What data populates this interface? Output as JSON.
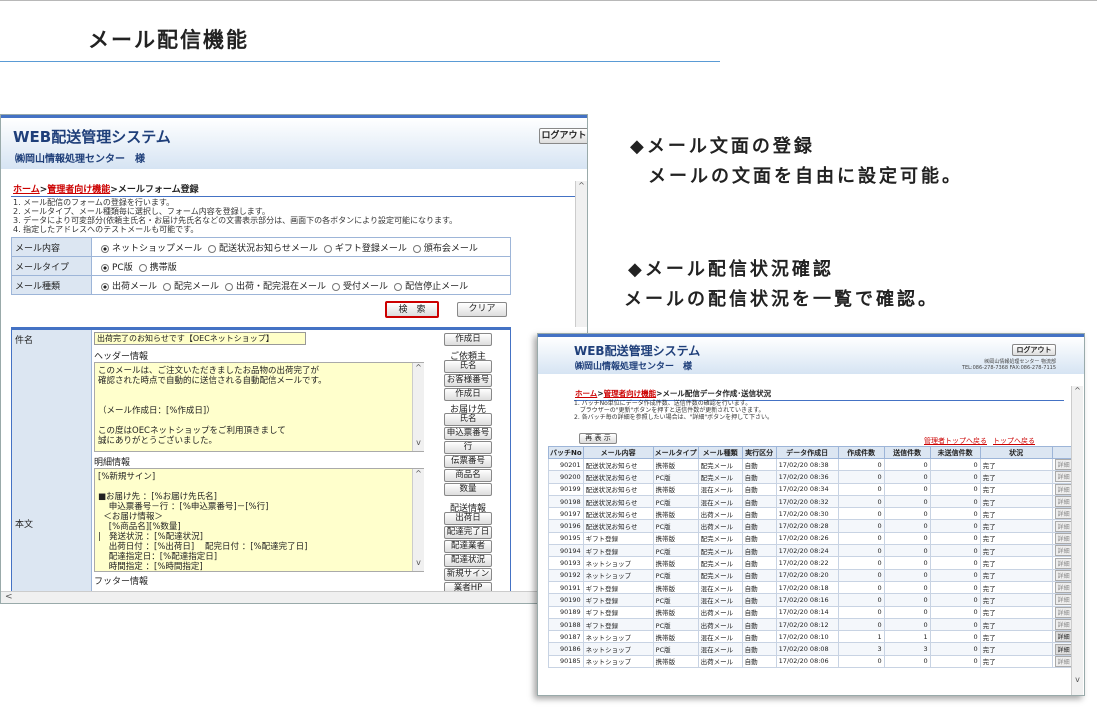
{
  "slide_title": "メール配信機能",
  "notes": {
    "n1_head": "◆メール文面の登録",
    "n1_body": "メールの文面を自由に設定可能。",
    "n2_head": "◆メール配信状況確認",
    "n2_body": "メールの配信状況を一覧で確認。"
  },
  "screen1": {
    "app_title": "WEB配送管理システム",
    "user": "㈱岡山情報処理センター　様",
    "logout": "ログアウト",
    "crumb_home": "ホーム",
    "crumb_sep": ">",
    "crumb_admin": "管理者向け機能",
    "crumb_page": ">メールフォーム登録",
    "instructions": [
      "1. メール配信のフォームの登録を行います。",
      "2. メールタイプ、メール種類毎に選択し、フォーム内容を登録します。",
      "3. データにより可変部分(依頼主氏名・お届け先氏名などの文書表示部分は、画面下の各ボタンにより設定可能になります。",
      "4. 指定したアドレスへのテストメールも可能です。"
    ],
    "form": [
      {
        "label": "メール内容",
        "options": [
          "ネットショップメール",
          "配送状況お知らせメール",
          "ギフト登録メール",
          "頒布会メール"
        ],
        "selected": 0
      },
      {
        "label": "メールタイプ",
        "options": [
          "PC版",
          "携帯版"
        ],
        "selected": 0
      },
      {
        "label": "メール種類",
        "options": [
          "出荷メール",
          "配完メール",
          "出荷・配完混在メール",
          "受付メール",
          "配信停止メール"
        ],
        "selected": 0
      }
    ],
    "search": "検　索",
    "clear": "クリア",
    "subject_label": "件名",
    "subject_value": "出荷完了のお知らせです【OECネットショップ】",
    "body_label": "本文",
    "header_label": "ヘッダー情報",
    "header_text": "このメールは、ご注文いただきましたお品物の出荷完了が\n確認された時点で自動的に送信される自動配信メールです。\n\n\n（メール作成日：[%作成日]）\n\nこの度はOECネットショップをご利用頂きまして\n誠にありがとうございました。",
    "detail_label": "明細情報",
    "detail_text": "[%新規サイン]\n\n■お届け先 ：[%お届け先氏名]\n    申込票番号－行 ：[%申込票番号]－[%行]\n  ＜お届け情報＞\n    [%商品名][%数量]\n|   発送状況 ：[%配達状況]\n    出荷日付 ：[%出荷日]    配完日付 ：[%配達完了日]\n    配達指定日：[%配達指定日]\n    時間指定 ：[%時間指定]",
    "footer_label": "フッター情報",
    "side_buttons": {
      "created": "作成日",
      "client_label": "ご依頼主",
      "name1": "氏名",
      "customer_no": "お客様番号",
      "created2": "作成日",
      "dest_label": "お届け先",
      "name2": "氏名",
      "app_no": "申込票番号",
      "line": "行",
      "slip_no": "伝票番号",
      "product": "商品名",
      "qty": "数量",
      "ship_info": "配送情報",
      "ship_date": "出荷日",
      "delivered_date": "配達完了日",
      "carrier": "配達業者",
      "status": "配達状況",
      "new_sign": "新規サイン",
      "carrier_hp": "業者HP"
    }
  },
  "screen2": {
    "app_title": "WEB配送管理システム",
    "user": "㈱岡山情報処理センター　様",
    "logout": "ログアウト",
    "address": "㈱岡山情報処理センター 物流部\nTEL:086-278-7368 FAX:086-278-7115",
    "crumb_home": "ホーム",
    "crumb_admin": "管理者向け機能",
    "crumb_page": ">メール配信データ作成･送信状況",
    "instructions": "1. バッチNo単位にデータ作成件数、送信件数の確認を行います。\n   ブラウザーの\"更新\"ボタンを押すと送信件数が更新されていきます。\n2. 各バッチ毎の詳細を参照したい場合は、\"詳細\"ボタンを押して下さい。",
    "refresh": "再 表 示",
    "link_admin_top": "管理者トップへ戻る",
    "link_top": "トップへ戻る",
    "columns": [
      "バッチNo",
      "メール内容",
      "メールタイプ",
      "メール種類",
      "実行区分",
      "データ作成日",
      "作成件数",
      "送信件数",
      "未送信件数",
      "状況",
      ""
    ],
    "detail_label": "詳細",
    "rows": [
      [
        "90201",
        "配送状況お知らせ",
        "携帯版",
        "配完メール",
        "自動",
        "17/02/20 08:38",
        "0",
        "0",
        "0",
        "完了"
      ],
      [
        "90200",
        "配送状況お知らせ",
        "PC版",
        "配完メール",
        "自動",
        "17/02/20 08:36",
        "0",
        "0",
        "0",
        "完了"
      ],
      [
        "90199",
        "配送状況お知らせ",
        "携帯版",
        "混在メール",
        "自動",
        "17/02/20 08:34",
        "0",
        "0",
        "0",
        "完了"
      ],
      [
        "90198",
        "配送状況お知らせ",
        "PC版",
        "混在メール",
        "自動",
        "17/02/20 08:32",
        "0",
        "0",
        "0",
        "完了"
      ],
      [
        "90197",
        "配送状況お知らせ",
        "携帯版",
        "出荷メール",
        "自動",
        "17/02/20 08:30",
        "0",
        "0",
        "0",
        "完了"
      ],
      [
        "90196",
        "配送状況お知らせ",
        "PC版",
        "出荷メール",
        "自動",
        "17/02/20 08:28",
        "0",
        "0",
        "0",
        "完了"
      ],
      [
        "90195",
        "ギフト登録",
        "携帯版",
        "配完メール",
        "自動",
        "17/02/20 08:26",
        "0",
        "0",
        "0",
        "完了"
      ],
      [
        "90194",
        "ギフト登録",
        "PC版",
        "配完メール",
        "自動",
        "17/02/20 08:24",
        "0",
        "0",
        "0",
        "完了"
      ],
      [
        "90193",
        "ネットショップ",
        "携帯版",
        "配完メール",
        "自動",
        "17/02/20 08:22",
        "0",
        "0",
        "0",
        "完了"
      ],
      [
        "90192",
        "ネットショップ",
        "PC版",
        "配完メール",
        "自動",
        "17/02/20 08:20",
        "0",
        "0",
        "0",
        "完了"
      ],
      [
        "90191",
        "ギフト登録",
        "携帯版",
        "混在メール",
        "自動",
        "17/02/20 08:18",
        "0",
        "0",
        "0",
        "完了"
      ],
      [
        "90190",
        "ギフト登録",
        "PC版",
        "混在メール",
        "自動",
        "17/02/20 08:16",
        "0",
        "0",
        "0",
        "完了"
      ],
      [
        "90189",
        "ギフト登録",
        "携帯版",
        "出荷メール",
        "自動",
        "17/02/20 08:14",
        "0",
        "0",
        "0",
        "完了"
      ],
      [
        "90188",
        "ギフト登録",
        "PC版",
        "出荷メール",
        "自動",
        "17/02/20 08:12",
        "0",
        "0",
        "0",
        "完了"
      ],
      [
        "90187",
        "ネットショップ",
        "携帯版",
        "混在メール",
        "自動",
        "17/02/20 08:10",
        "1",
        "1",
        "0",
        "完了"
      ],
      [
        "90186",
        "ネットショップ",
        "PC版",
        "混在メール",
        "自動",
        "17/02/20 08:08",
        "3",
        "3",
        "0",
        "完了"
      ],
      [
        "90185",
        "ネットショップ",
        "携帯版",
        "出荷メール",
        "自動",
        "17/02/20 08:06",
        "0",
        "0",
        "0",
        "完了"
      ]
    ],
    "detail_enabled": [
      false,
      false,
      false,
      false,
      false,
      false,
      false,
      false,
      false,
      false,
      false,
      false,
      false,
      false,
      true,
      true,
      false
    ]
  }
}
